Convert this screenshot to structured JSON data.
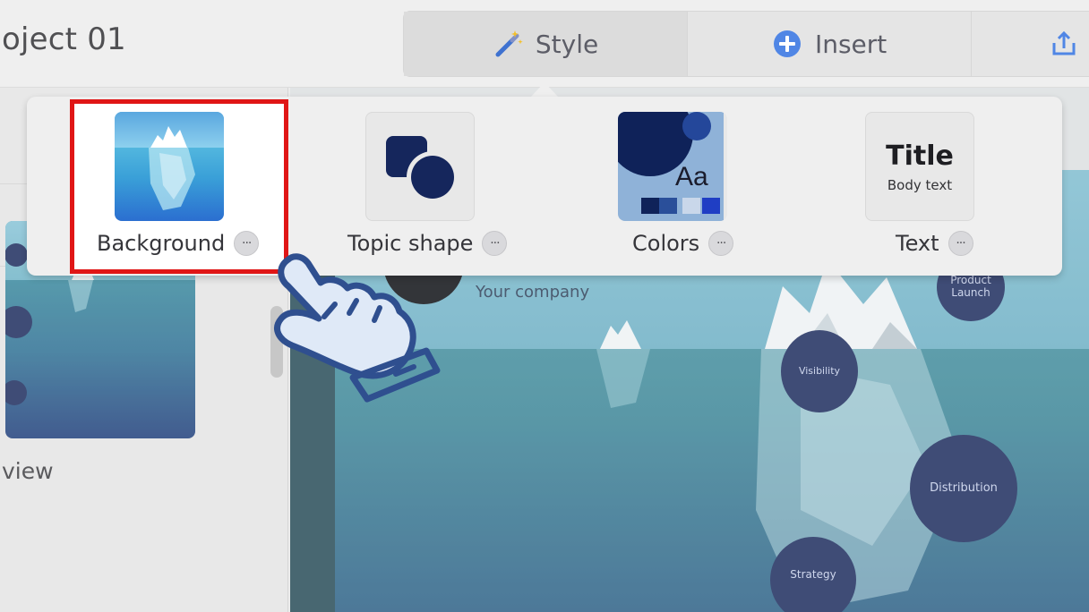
{
  "header": {
    "project_title": "oject 01",
    "tabs": [
      {
        "label": "Style",
        "icon": "magic-wand-icon"
      },
      {
        "label": "Insert",
        "icon": "plus-circle-icon"
      },
      {
        "label": "",
        "icon": "share-upload-icon"
      }
    ]
  },
  "sidebar": {
    "preview_label": "view"
  },
  "slide": {
    "company": "Your company",
    "topics": [
      "Product Launch",
      "Visibility",
      "Distribution",
      "Strategy"
    ]
  },
  "style_popup": {
    "options": [
      {
        "label": "Background",
        "more": "···"
      },
      {
        "label": "Topic shape",
        "more": "···"
      },
      {
        "label": "Colors",
        "more": "···"
      },
      {
        "label": "Text",
        "more": "···"
      }
    ],
    "colors_preview_text": "Aa",
    "text_preview": {
      "title": "Title",
      "body": "Body text"
    }
  },
  "colors": {
    "accent_blue": "#1b58c8",
    "topic_navy": "#1b2a5c",
    "highlight_red": "#e01616",
    "water_teal": "#3f8f9c"
  }
}
